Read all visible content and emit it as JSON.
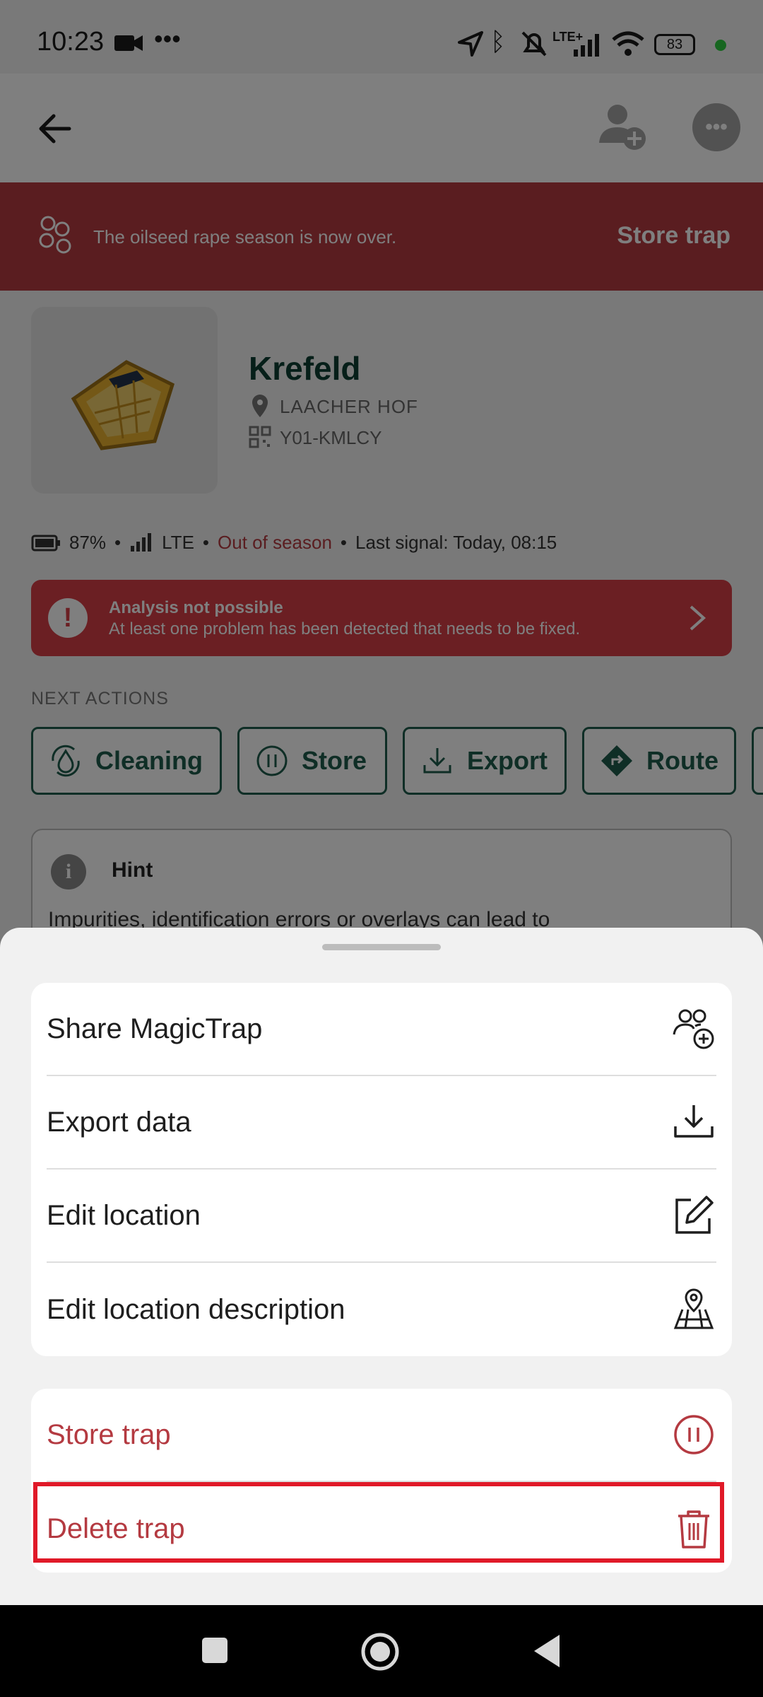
{
  "status_bar": {
    "time": "10:23",
    "network": "LTE+",
    "battery": "83"
  },
  "banner": {
    "message": "The oilseed rape season is now over.",
    "action_label": "Store trap"
  },
  "device": {
    "name": "Krefeld",
    "location": "LAACHER HOF",
    "id": "Y01-KMLCY",
    "battery": "87%",
    "network": "LTE",
    "season_status": "Out of season",
    "last_signal": "Last signal: Today, 08:15"
  },
  "alert": {
    "title": "Analysis not possible",
    "message": "At least one problem has been detected that needs to be fixed."
  },
  "next_actions": {
    "title": "NEXT ACTIONS",
    "items": [
      {
        "label": "Cleaning",
        "icon": "cleaning-icon"
      },
      {
        "label": "Store",
        "icon": "pause-icon"
      },
      {
        "label": "Export",
        "icon": "download-icon"
      },
      {
        "label": "Route",
        "icon": "route-icon"
      }
    ]
  },
  "hint": {
    "title": "Hint",
    "body": "Impurities, identification errors or overlays can lead to"
  },
  "sheet": {
    "group1": [
      {
        "label": "Share MagicTrap",
        "icon": "share-users-icon"
      },
      {
        "label": "Export data",
        "icon": "download-icon"
      },
      {
        "label": "Edit location",
        "icon": "edit-icon"
      },
      {
        "label": "Edit location description",
        "icon": "map-pin-icon"
      }
    ],
    "group2": [
      {
        "label": "Store trap",
        "icon": "pause-circle-icon"
      },
      {
        "label": "Delete trap",
        "icon": "trash-icon"
      }
    ]
  },
  "colors": {
    "brand_green": "#1f5d4d",
    "danger_red": "#b43a41",
    "alert_red": "#d73f47",
    "highlight": "#e01928"
  }
}
